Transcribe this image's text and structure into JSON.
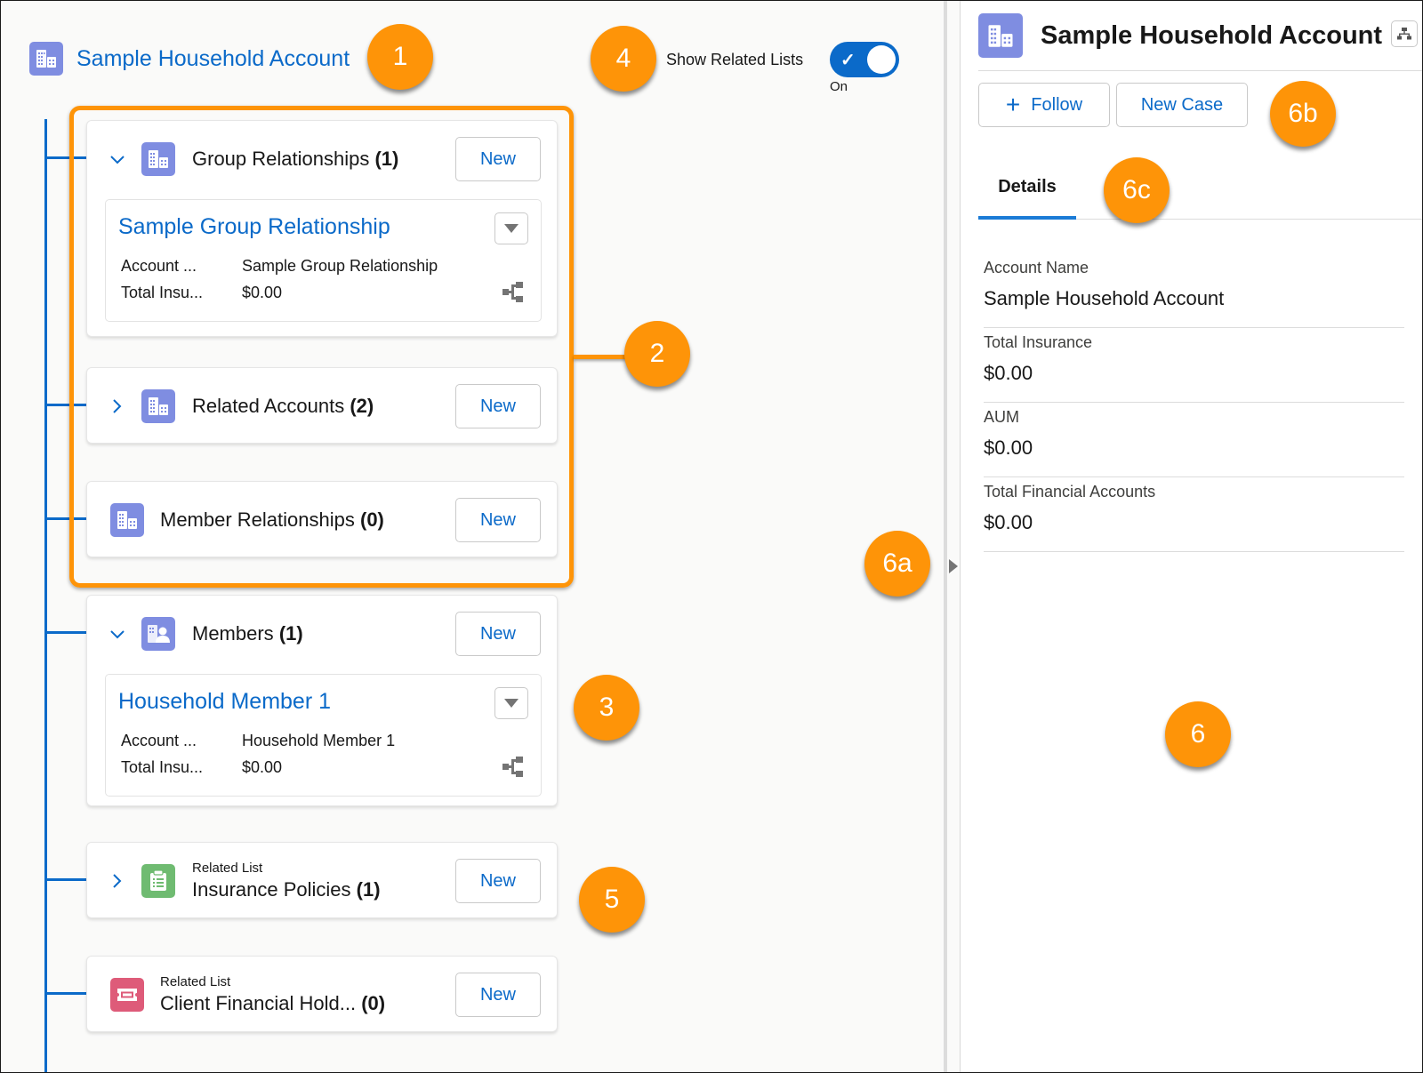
{
  "root": {
    "title": "Sample Household Account",
    "icon": "account-building-icon"
  },
  "toggle": {
    "label": "Show Related Lists",
    "state_label": "On",
    "checked": true
  },
  "cards": [
    {
      "title": "Group Relationships",
      "count": "(1)",
      "expanded": true,
      "icon": "account-building-icon",
      "new_label": "New",
      "record": {
        "title": "Sample Group Relationship",
        "fields": [
          {
            "label": "Account ...",
            "value": "Sample Group Relationship"
          },
          {
            "label": "Total Insu...",
            "value": "$0.00"
          }
        ]
      }
    },
    {
      "title": "Related Accounts",
      "count": "(2)",
      "expanded": false,
      "icon": "account-building-icon",
      "new_label": "New"
    },
    {
      "title": "Member Relationships",
      "count": "(0)",
      "icon": "account-building-icon",
      "new_label": "New"
    },
    {
      "title": "Members",
      "count": "(1)",
      "expanded": true,
      "icon": "account-member-icon",
      "new_label": "New",
      "record": {
        "title": "Household Member 1",
        "fields": [
          {
            "label": "Account ...",
            "value": "Household Member 1"
          },
          {
            "label": "Total Insu...",
            "value": "$0.00"
          }
        ]
      }
    },
    {
      "subtitle": "Related List",
      "title": "Insurance Policies",
      "count": "(1)",
      "expanded": false,
      "icon": "clipboard-list-icon",
      "new_label": "New"
    },
    {
      "subtitle": "Related List",
      "title": "Client Financial Hold...",
      "count": "(0)",
      "icon": "ticket-icon",
      "new_label": "New"
    }
  ],
  "annotations": [
    "1",
    "2",
    "3",
    "4",
    "5",
    "6",
    "6a",
    "6b",
    "6c"
  ],
  "detail_panel": {
    "title": "Sample Household Account",
    "follow_label": "Follow",
    "new_case_label": "New Case",
    "tab": "Details",
    "fields": [
      {
        "label": "Account Name",
        "value": "Sample Household Account"
      },
      {
        "label": "Total Insurance",
        "value": "$0.00"
      },
      {
        "label": "AUM",
        "value": "$0.00"
      },
      {
        "label": "Total Financial Accounts",
        "value": "$0.00"
      }
    ]
  },
  "colors": {
    "brand_blue": "#0b6ac9",
    "account_icon": "#7f8de1",
    "insurance_icon": "#6fbb71",
    "financial_holding_icon": "#de5b79",
    "annotation_orange": "#fe9408"
  }
}
